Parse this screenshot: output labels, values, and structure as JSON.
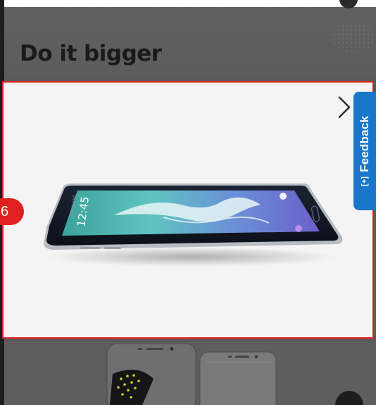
{
  "banner": {
    "headline": "Do it bigger"
  },
  "product": {
    "screen_time": "12:45",
    "next_icon": "chevron-right-icon",
    "badge_number": "6"
  },
  "feedback": {
    "icon_text": "[+]",
    "label": "Feedback",
    "color": "#1976c9"
  },
  "colors": {
    "highlight": "#e02020",
    "badge": "#e0211f",
    "overlay": "#5a5a5a",
    "card_bg": "#f4f4f4"
  }
}
